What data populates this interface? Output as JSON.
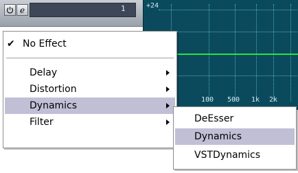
{
  "plugin_slot": {
    "power_icon": "power-icon",
    "edit_icon": "edit-icon",
    "edit_glyph": "e",
    "slot_number": "1"
  },
  "eq_display": {
    "db_label": "+24",
    "freq_labels": [
      "100",
      "500",
      "1k",
      "2k"
    ],
    "curve_color": "#27e43d",
    "background_color": "#0b4a5c"
  },
  "effect_menu": {
    "items": [
      {
        "label": "No Effect",
        "checked": true,
        "submenu": false
      },
      {
        "label": "Delay",
        "submenu": true
      },
      {
        "label": "Distortion",
        "submenu": true
      },
      {
        "label": "Dynamics",
        "submenu": true,
        "highlighted": true
      },
      {
        "label": "Filter",
        "submenu": true
      }
    ],
    "check_glyph": "✔",
    "highlight_color": "#c1bfd6"
  },
  "dynamics_submenu": {
    "items": [
      {
        "label": "DeEsser"
      },
      {
        "label": "Dynamics",
        "highlighted": true
      },
      {
        "label": "VSTDynamics"
      }
    ]
  }
}
